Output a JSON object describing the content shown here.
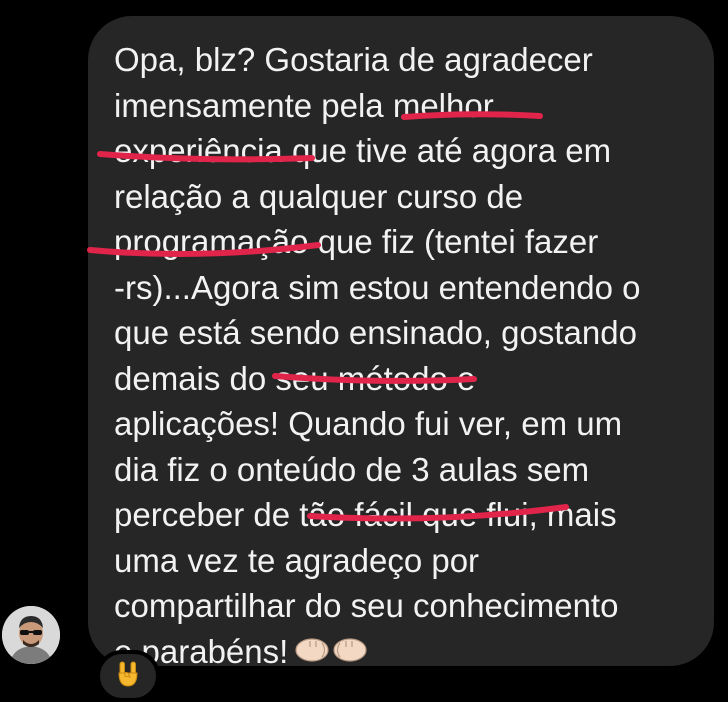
{
  "message": {
    "lines": [
      "Opa, blz? Gostaria de agradecer",
      "imensamente pela melhor",
      "experiência que tive até agora em",
      "relação a qualquer curso de",
      "programação que fiz (tentei fazer",
      "-rs)...Agora sim estou entendendo o",
      "que está sendo ensinado, gostando",
      "demais do seu método e",
      "aplicações! Quando fui ver, em um",
      "dia fiz o onteúdo de 3 aulas sem",
      "perceber de tão fácil que flui, mais",
      "uma vez te agradeço por",
      "compartilhar do seu conhecimento",
      "e parabéns!"
    ],
    "trailing_icon": "fist-bump-icon"
  },
  "highlights": [
    "melhor",
    "experiência",
    "programação",
    "seu método",
    "tão fácil que flui,"
  ],
  "reaction": {
    "icon": "rock-hand-icon"
  },
  "sender": {
    "avatar_icon": "avatar-with-sunglasses"
  },
  "colors": {
    "background": "#000000",
    "bubble": "#262626",
    "text": "#f2f2f2",
    "underline": "#e0244a"
  }
}
